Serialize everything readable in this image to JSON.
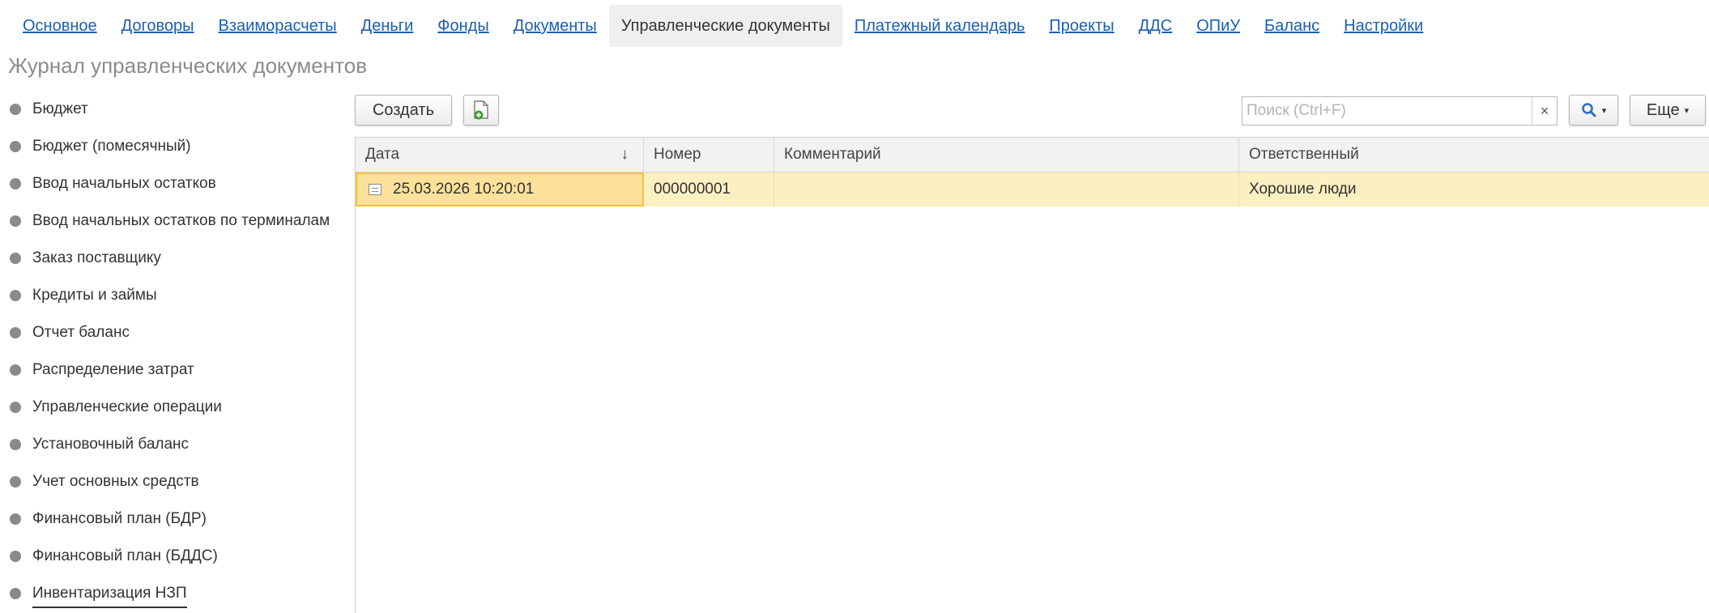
{
  "nav": {
    "tabs": [
      {
        "label": "Основное"
      },
      {
        "label": "Договоры"
      },
      {
        "label": "Взаиморасчеты"
      },
      {
        "label": "Деньги"
      },
      {
        "label": "Фонды"
      },
      {
        "label": "Документы"
      },
      {
        "label": "Управленческие документы",
        "active": true
      },
      {
        "label": "Платежный календарь"
      },
      {
        "label": "Проекты"
      },
      {
        "label": "ДДС"
      },
      {
        "label": "ОПиУ"
      },
      {
        "label": "Баланс"
      },
      {
        "label": "Настройки"
      }
    ]
  },
  "page": {
    "title": "Журнал управленческих документов"
  },
  "sidebar": {
    "items": [
      {
        "label": "Бюджет"
      },
      {
        "label": "Бюджет (помесячный)"
      },
      {
        "label": "Ввод начальных остатков"
      },
      {
        "label": "Ввод начальных остатков по терминалам"
      },
      {
        "label": "Заказ поставщику"
      },
      {
        "label": "Кредиты и займы"
      },
      {
        "label": "Отчет баланс"
      },
      {
        "label": "Распределение затрат"
      },
      {
        "label": "Управленческие операции"
      },
      {
        "label": "Установочный баланс"
      },
      {
        "label": "Учет основных средств"
      },
      {
        "label": "Финансовый план (БДР)"
      },
      {
        "label": "Финансовый план (БДДС)"
      },
      {
        "label": "Инвентаризация НЗП",
        "active": true
      }
    ]
  },
  "toolbar": {
    "create_label": "Создать",
    "search_placeholder": "Поиск (Ctrl+F)",
    "search_value": "",
    "clear_label": "×",
    "more_label": "Еще",
    "caret": "▾"
  },
  "table": {
    "columns": [
      {
        "label": "Дата",
        "sort": "↓"
      },
      {
        "label": "Номер"
      },
      {
        "label": "Комментарий"
      },
      {
        "label": "Ответственный"
      }
    ],
    "rows": [
      {
        "date": "25.03.2026 10:20:01",
        "number": "000000001",
        "comment": "",
        "responsible": "Хорошие люди"
      }
    ]
  },
  "colors": {
    "link": "#1a5fb4",
    "selected_row": "#fcf0c2",
    "focused_cell_border": "#f2c23a",
    "add_icon_green": "#3aa635",
    "search_icon_blue": "#2a6fc9"
  }
}
